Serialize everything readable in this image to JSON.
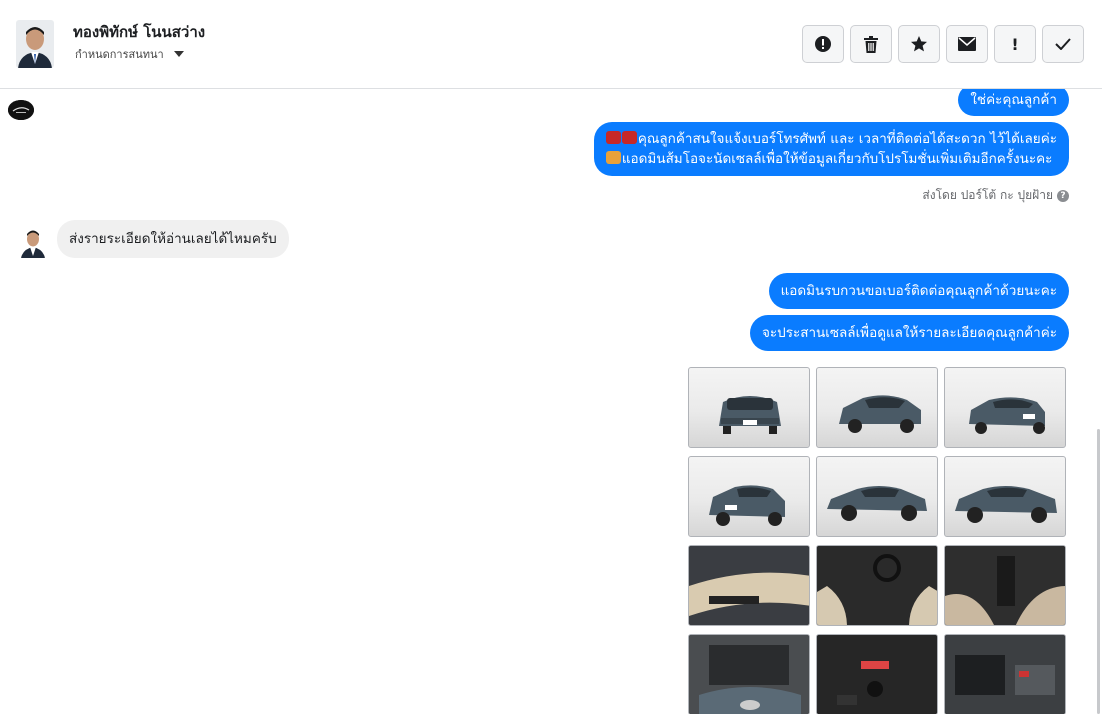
{
  "header": {
    "contact_name": "ทองพิทักษ์ โนนสว่าง",
    "assign_label": "กำหนดการสนทนา",
    "actions": [
      {
        "icon": "alert-circle-icon",
        "name": "mark-spam-button"
      },
      {
        "icon": "trash-icon",
        "name": "delete-button"
      },
      {
        "icon": "star-icon",
        "name": "star-button"
      },
      {
        "icon": "envelope-icon",
        "name": "mark-unread-button"
      },
      {
        "icon": "exclamation-icon",
        "name": "follow-up-button",
        "text": "!"
      },
      {
        "icon": "check-icon",
        "name": "mark-done-button"
      }
    ]
  },
  "messages": {
    "out_top": "ใช่ค่ะคุณลูกค้า",
    "out_phone_line1": "คุณลูกค้าสนใจแจ้งเบอร์โทรศัพท์ และ เวลาที่ติดต่อได้สะดวก ไว้ได้เลยค่ะ",
    "out_phone_line2": "แอดมินส้มโอจะนัดเซลล์เพื่อให้ข้อมูลเกี่ยวกับโปรโมชั่นเพิ่มเติมอีกครั้งนะคะ",
    "sent_by": "ส่งโดย ปอร์โต้ กะ ปุยฝ้าย",
    "in_request": "ส่งรายระเอียดให้อ่านเลยได้ไหมครับ",
    "out_ask_phone": "แอดมินรบกวนขอเบอร์ติดต่อคุณลูกค้าด้วยนะคะ",
    "out_coordinate": "จะประสานเซลล์เพื่อดูแลให้รายละเอียดคุณลูกค้าค่ะ"
  },
  "photos": [
    {
      "kind": "exterior",
      "view": "front"
    },
    {
      "kind": "exterior",
      "view": "front-angle"
    },
    {
      "kind": "exterior",
      "view": "rear-angle"
    },
    {
      "kind": "exterior",
      "view": "rear"
    },
    {
      "kind": "exterior",
      "view": "side"
    },
    {
      "kind": "exterior",
      "view": "side-angle"
    },
    {
      "kind": "interior",
      "view": "door-panel"
    },
    {
      "kind": "interior",
      "view": "dashboard"
    },
    {
      "kind": "interior",
      "view": "gear-console"
    },
    {
      "kind": "engine",
      "view": "engine-bay"
    },
    {
      "kind": "interior",
      "view": "center-console"
    },
    {
      "kind": "engine",
      "view": "engine-detail"
    }
  ],
  "colors": {
    "outgoing_bubble": "#0a7cff",
    "incoming_bubble": "#f0f0f0",
    "car_body": "#4a5a66"
  }
}
